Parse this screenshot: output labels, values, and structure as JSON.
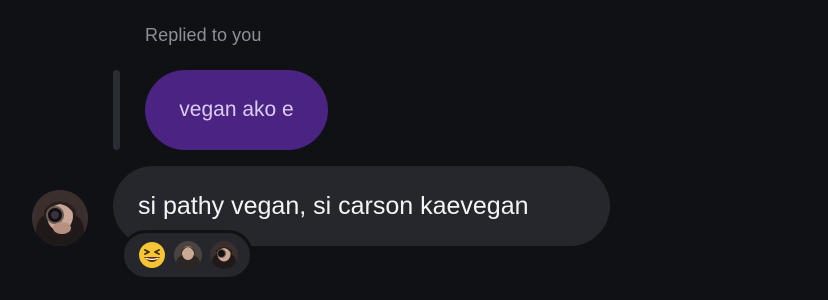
{
  "reply": {
    "label": "Replied to you",
    "quoted_text": "vegan ako e"
  },
  "message": {
    "text": "si pathy vegan, si carson kaevegan"
  },
  "reactions": {
    "emoji": "grinning-squinting-face"
  },
  "colors": {
    "background": "#0f1115",
    "quoted_bubble": "#4b2383",
    "message_bubble": "#25272c",
    "label": "#8b8f97"
  }
}
